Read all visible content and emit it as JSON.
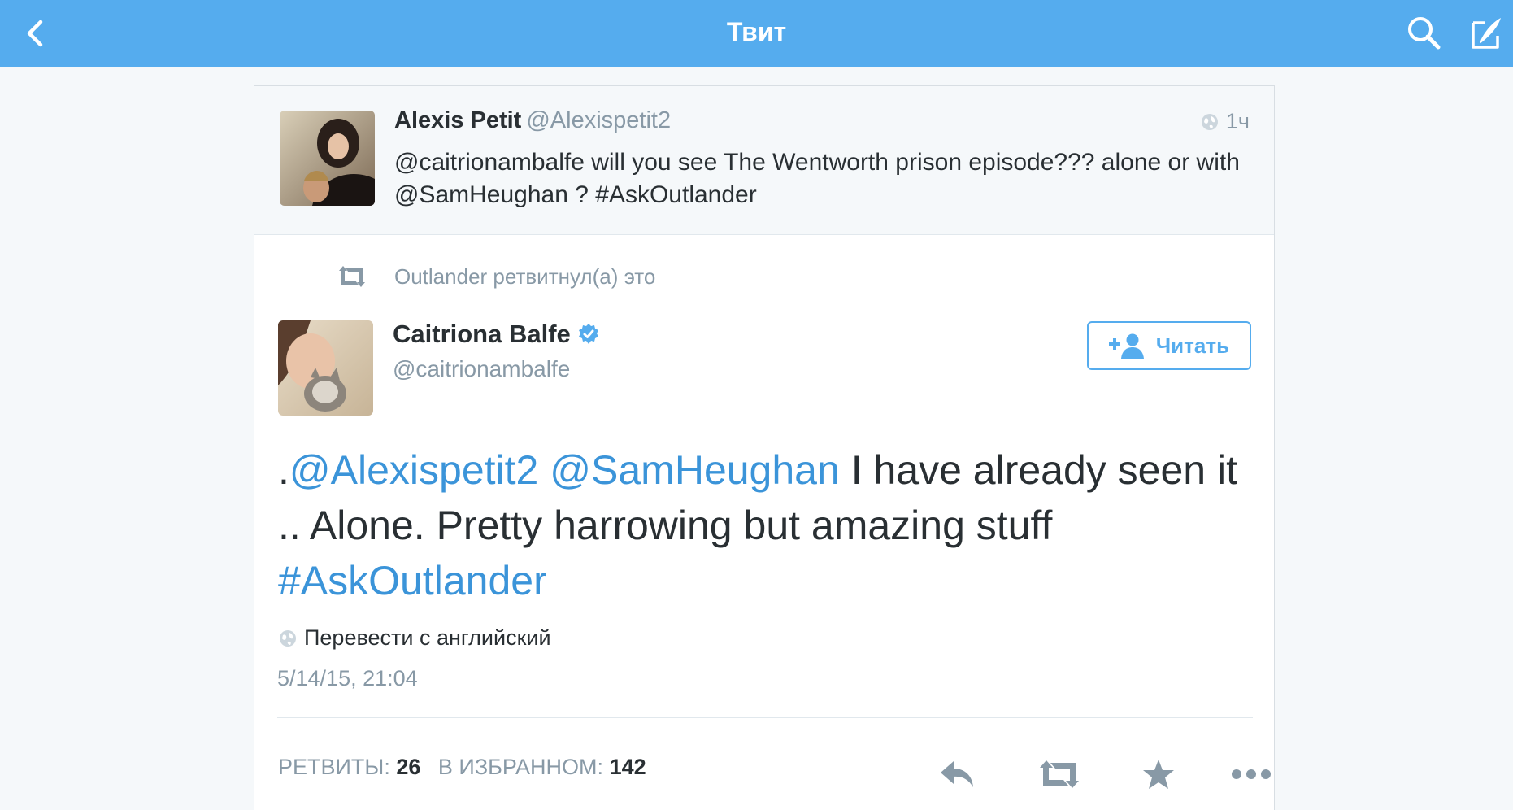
{
  "header": {
    "title": "Твит",
    "back_icon": "chevron-left-icon",
    "search_icon": "search-icon",
    "compose_icon": "compose-icon",
    "bg_color": "#55acee"
  },
  "parent_tweet": {
    "name": "Alexis Petit",
    "handle": "@Alexispetit2",
    "time": "1ч",
    "text": "@caitrionambalfe will you see The Wentworth prison episode??? alone or with @SamHeughan ? #AskOutlander"
  },
  "retweet_context": {
    "text": "Outlander ретвитнул(а) это"
  },
  "main_tweet": {
    "name": "Caitriona Balfe",
    "verified": true,
    "handle": "@caitrionambalfe",
    "follow_label": "Читать",
    "text_parts": {
      "prefix": ".",
      "mention1": "@Alexispetit2",
      "space1": " ",
      "mention2": "@SamHeughan",
      "body": " I have already seen it .. Alone. Pretty harrowing but amazing stuff ",
      "hashtag": "#AskOutlander"
    },
    "translate_label": "Перевести с английский",
    "timestamp": "5/14/15, 21:04",
    "stats": {
      "retweets_label": "РЕТВИТЫ:",
      "retweets_count": "26",
      "favorites_label": "В ИЗБРАННОМ:",
      "favorites_count": "142"
    },
    "actions": [
      "reply-icon",
      "retweet-icon",
      "favorite-star-icon",
      "more-dots-icon"
    ]
  },
  "colors": {
    "accent": "#55acee",
    "link": "#3b94d9",
    "muted": "#8899a6",
    "text": "#292f33"
  }
}
